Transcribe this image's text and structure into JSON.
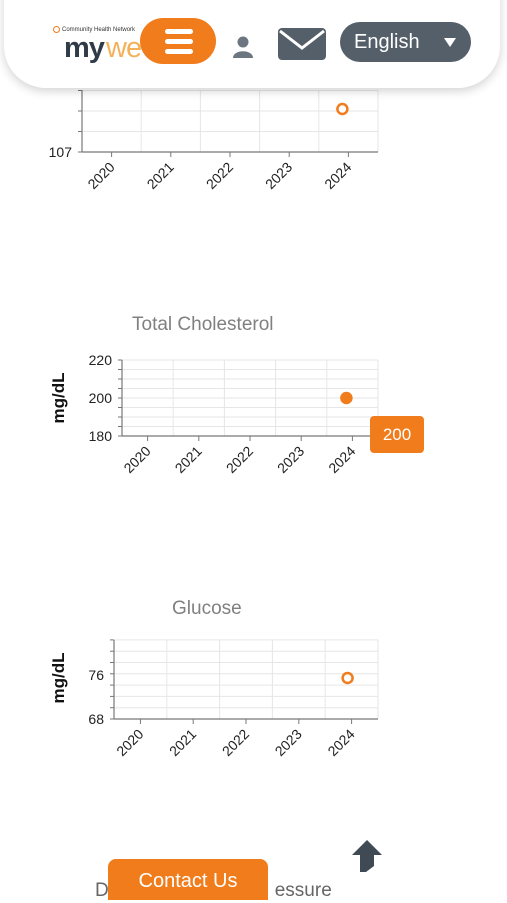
{
  "header": {
    "logo_small": "Community Health Network",
    "logo_my": "my",
    "logo_we": "we",
    "language": "English"
  },
  "colors": {
    "accent": "#f07c1c",
    "dark": "#545f6a"
  },
  "icons": {
    "menu": "hamburger-menu-icon",
    "user": "user-icon",
    "mail": "mail-icon",
    "lang_caret": "caret-down-icon",
    "home": "home-icon"
  },
  "chart_data": [
    {
      "type": "scatter",
      "title": "",
      "ylabel": "",
      "x": [
        "2020",
        "2021",
        "2022",
        "2023",
        "2024"
      ],
      "yticks": [
        "107"
      ],
      "points": [
        {
          "x": "2024",
          "filled": false
        }
      ]
    },
    {
      "type": "scatter",
      "title": "Total Cholesterol",
      "ylabel": "mg/dL",
      "x": [
        "2020",
        "2021",
        "2022",
        "2023",
        "2024"
      ],
      "ylim": [
        180,
        220
      ],
      "yticks": [
        "220",
        "200",
        "180"
      ],
      "points": [
        {
          "x": "2024",
          "y": 200,
          "filled": true
        }
      ],
      "tooltip": "200"
    },
    {
      "type": "scatter",
      "title": "Glucose",
      "ylabel": "mg/dL",
      "x": [
        "2020",
        "2021",
        "2022",
        "2023",
        "2024"
      ],
      "yticks": [
        "76",
        "68"
      ],
      "points": [
        {
          "x": "2024",
          "y": 76,
          "filled": false
        }
      ]
    }
  ],
  "footer": {
    "contact": "Contact Us",
    "next_title_left": "D",
    "next_title_right": "essure"
  }
}
